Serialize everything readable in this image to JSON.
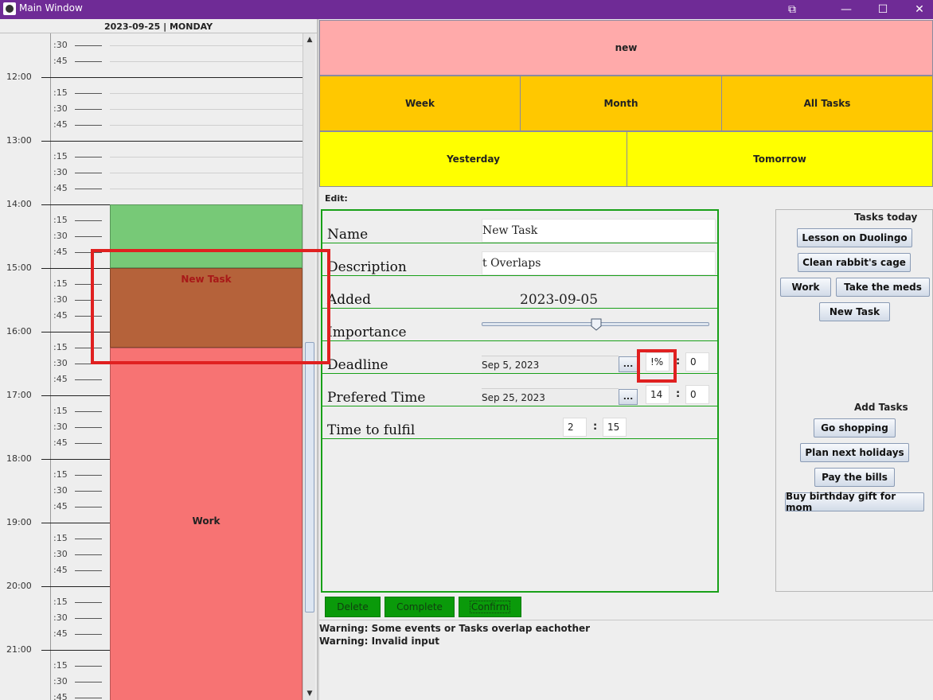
{
  "window": {
    "title": "Main Window",
    "buttons": [
      "⧉",
      "—",
      "☐",
      "✕"
    ]
  },
  "calendar": {
    "date_header": "2023-09-25 | MONDAY",
    "hours": [
      "12:00",
      "13:00",
      "14:00",
      "15:00",
      "16:00",
      "17:00",
      "18:00",
      "19:00",
      "20:00",
      "21:00"
    ],
    "quarters": [
      ":15",
      ":30",
      ":45"
    ],
    "top_quarters": [
      ":30",
      ":45"
    ],
    "events": [
      {
        "name": "",
        "color": "#77c977"
      },
      {
        "name": "New Task",
        "color": "#b5623a"
      },
      {
        "name": "Work",
        "color": "#f77373"
      }
    ]
  },
  "nav": {
    "new": "new",
    "week": "Week",
    "month": "Month",
    "all_tasks": "All Tasks",
    "yesterday": "Yesterday",
    "tomorrow": "Tomorrow"
  },
  "edit": {
    "label": "Edit:",
    "name_label": "Name",
    "name_value": "New Task",
    "description_label": "Description",
    "description_value": "t Overlaps",
    "added_label": "Added",
    "added_value": "2023-09-05",
    "importance_label": "Importance",
    "importance_level": 0.5,
    "deadline_label": "Deadline",
    "deadline_date": "Sep 5, 2023",
    "deadline_hour": "!%",
    "deadline_minute": "0",
    "preferred_label": "Prefered Time",
    "preferred_date": "Sep 25, 2023",
    "preferred_hour": "14",
    "preferred_minute": "0",
    "fulfil_label": "Time to fulfil",
    "fulfil_hours": "2",
    "fulfil_minutes": "15",
    "date_button": "...",
    "colon": ":"
  },
  "actions": {
    "delete": "Delete",
    "complete": "Complete",
    "confirm": "Confirm"
  },
  "warnings": [
    "Warning: Some events or Tasks overlap eachother",
    "Warning: Invalid input"
  ],
  "side": {
    "tasks_today_title": "Tasks today",
    "tasks_today": [
      "Lesson on Duolingo",
      "Clean rabbit's cage",
      "Work",
      "Take the meds",
      "New Task"
    ],
    "add_tasks_title": "Add Tasks",
    "add_tasks": [
      "Go shopping",
      "Plan next holidays",
      "Pay the bills",
      "Buy birthday gift for mom"
    ]
  },
  "colors": {
    "titlebar": "#6f2b96",
    "new": "#ffaaaa",
    "nav_orange": "#ffc800",
    "nav_yellow": "#ffff00",
    "edit_border": "#18a018",
    "action_green": "#0a9a0a",
    "highlight": "#e02020"
  }
}
